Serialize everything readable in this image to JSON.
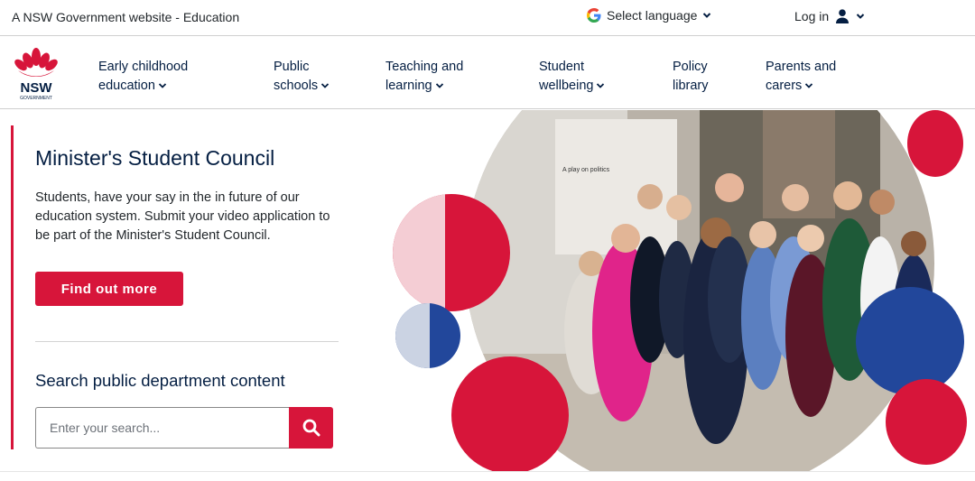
{
  "topbar": {
    "gov_text": "A NSW Government website - Education",
    "language_label": "Select language",
    "login_label": "Log in"
  },
  "logo": {
    "wordmark": "NSW",
    "sub": "GOVERNMENT"
  },
  "nav": {
    "items": [
      {
        "line1": "Early childhood",
        "line2": "education"
      },
      {
        "line1": "Public",
        "line2": "schools"
      },
      {
        "line1": "Teaching and",
        "line2": "learning"
      },
      {
        "line1": "Student",
        "line2": "wellbeing"
      },
      {
        "line1": "Policy",
        "line2": "library"
      },
      {
        "line1": "Parents and",
        "line2": "carers"
      }
    ]
  },
  "feature": {
    "title": "Minister's Student Council",
    "description": "Students, have your say in the in future of our education system. Submit your video application to be part of the Minister's Student Council.",
    "cta_label": "Find out more"
  },
  "search": {
    "title": "Search public department content",
    "placeholder": "Enter your search..."
  },
  "hero": {
    "banner_text": "A play on politics"
  },
  "colors": {
    "brand_red": "#d7153a",
    "brand_navy": "#041e42",
    "accent_blue": "#22479b",
    "light_pink": "#f4cdd4",
    "light_blue": "#cbd3e3"
  },
  "icons": {
    "language": "google-g-icon",
    "account": "user-icon",
    "search": "magnifier-icon",
    "dropdown": "chevron-down-icon"
  }
}
